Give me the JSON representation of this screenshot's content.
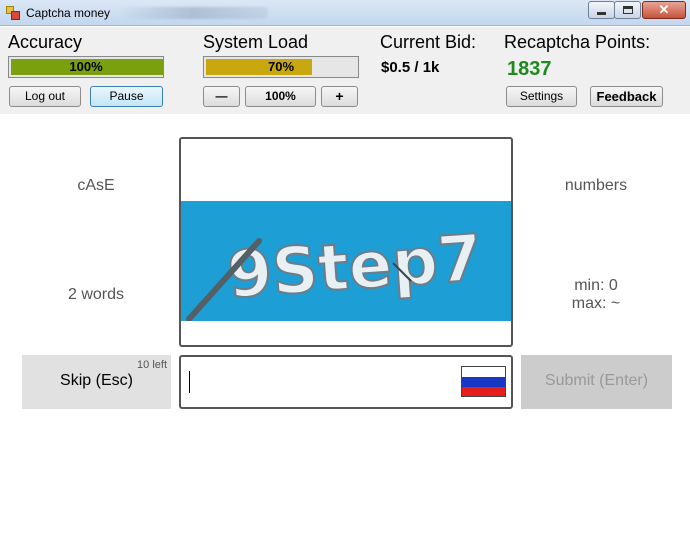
{
  "window": {
    "title": "Captcha money",
    "controls": {
      "minimize": "minimize-icon",
      "maximize": "maximize-icon",
      "close": "✕"
    }
  },
  "stats": {
    "accuracy": {
      "label": "Accuracy",
      "value": "100%",
      "fraction": 1.0,
      "color": "#7aa010"
    },
    "system_load": {
      "label": "System Load",
      "value": "70%",
      "fraction": 0.7,
      "color": "#c9a80f"
    },
    "current_bid": {
      "label": "Current Bid:",
      "value": "$0.5 / 1k"
    },
    "recaptcha_points": {
      "label": "Recaptcha Points:",
      "value": "1837",
      "color": "#1e8a1e"
    }
  },
  "buttons": {
    "logout": "Log out",
    "pause": "Pause",
    "decrease": "—",
    "zoom": "100%",
    "increase": "+",
    "settings": "Settings",
    "feedback": "Feedback"
  },
  "hints": {
    "case": "cAsE",
    "words": "2 words",
    "numbers": "numbers",
    "min": "min: 0",
    "max": "max: ~"
  },
  "captcha": {
    "text": "9Step7",
    "background_color": "#1d9fd6"
  },
  "skip": {
    "label": "Skip (Esc)",
    "remaining": "10 left"
  },
  "answer": {
    "value": "",
    "flag": "russia-flag-icon"
  },
  "submit": {
    "label": "Submit (Enter)"
  }
}
